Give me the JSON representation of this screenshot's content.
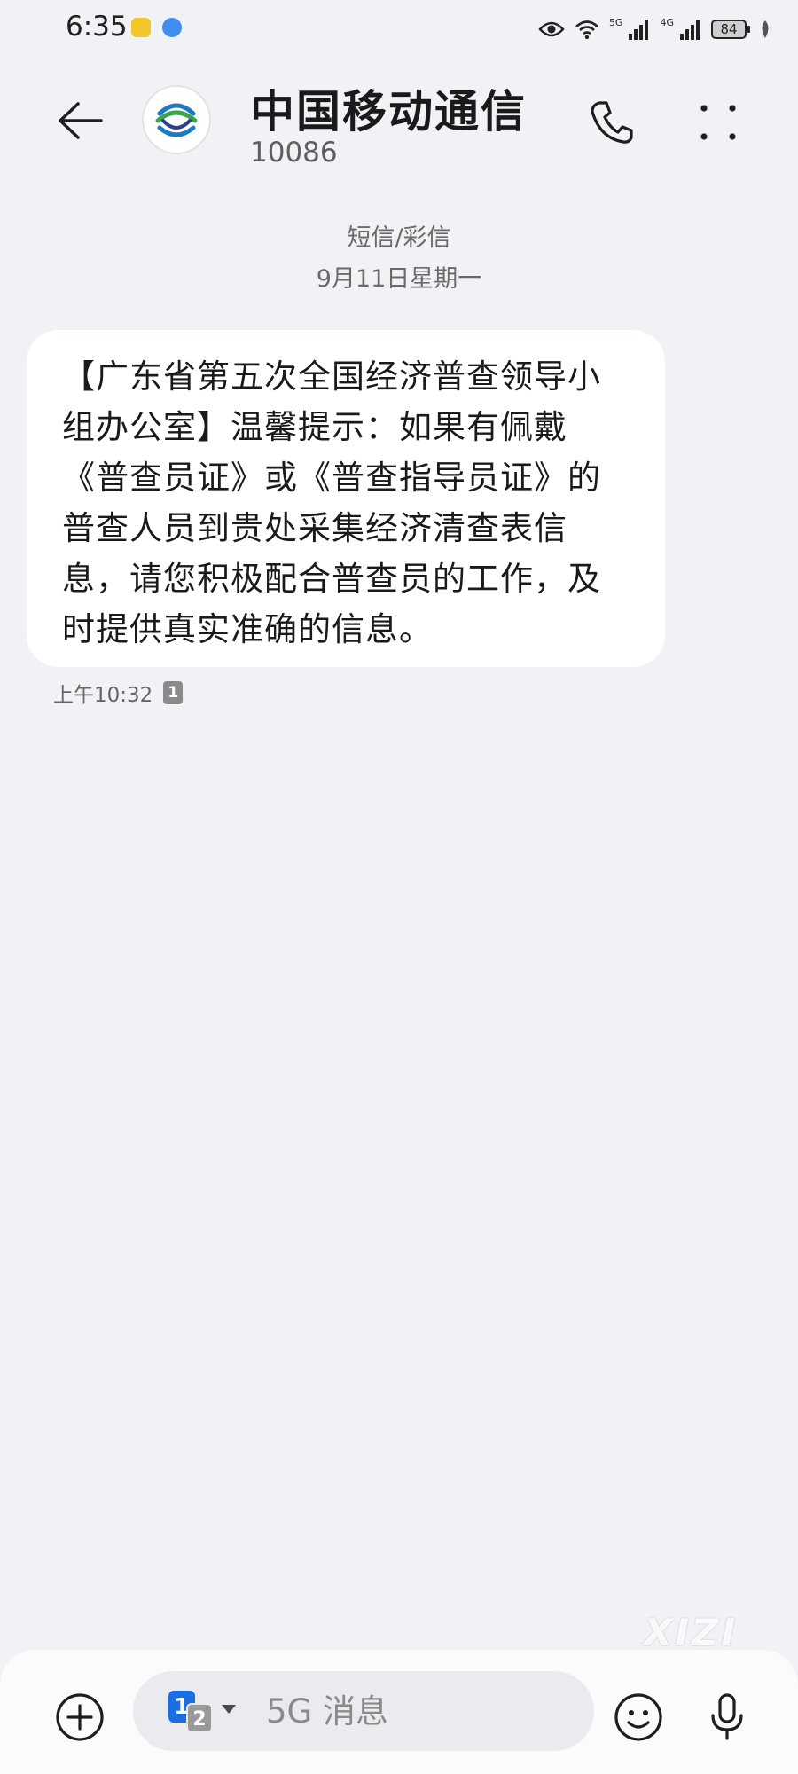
{
  "status_bar": {
    "time": "6:35",
    "net1": "5G",
    "net2": "4G",
    "battery": "84",
    "icons": [
      "notification-app-icon",
      "notification-app-icon",
      "eye-icon",
      "wifi-icon",
      "signal-icon",
      "signal-icon",
      "battery-icon",
      "leaf-icon"
    ]
  },
  "header": {
    "contact_name": "中国移动通信",
    "contact_number": "10086",
    "icons": [
      "back-arrow-icon",
      "china-mobile-logo",
      "phone-icon",
      "more-dots-icon"
    ]
  },
  "conversation": {
    "message_type": "短信/彩信",
    "date": "9月11日星期一",
    "messages": [
      {
        "text": "【广东省第五次全国经济普查领导小\n组办公室】温馨提示：如果有佩戴\n《普查员证》或《普查指导员证》的\n普查人员到贵处采集经济清查表信\n息，请您积极配合普查员的工作，及\n时提供真实准确的信息。",
        "time": "上午10:32",
        "sim": "1"
      }
    ]
  },
  "watermark": "XIZI",
  "composer": {
    "placeholder": "5G 消息",
    "sim_primary": "1",
    "sim_secondary": "2",
    "icons": [
      "add-icon",
      "emoji-icon",
      "microphone-icon"
    ]
  },
  "colors": {
    "background": "#f1f2f5",
    "bubble": "#ffffff",
    "sim_blue": "#1b6fe0"
  }
}
